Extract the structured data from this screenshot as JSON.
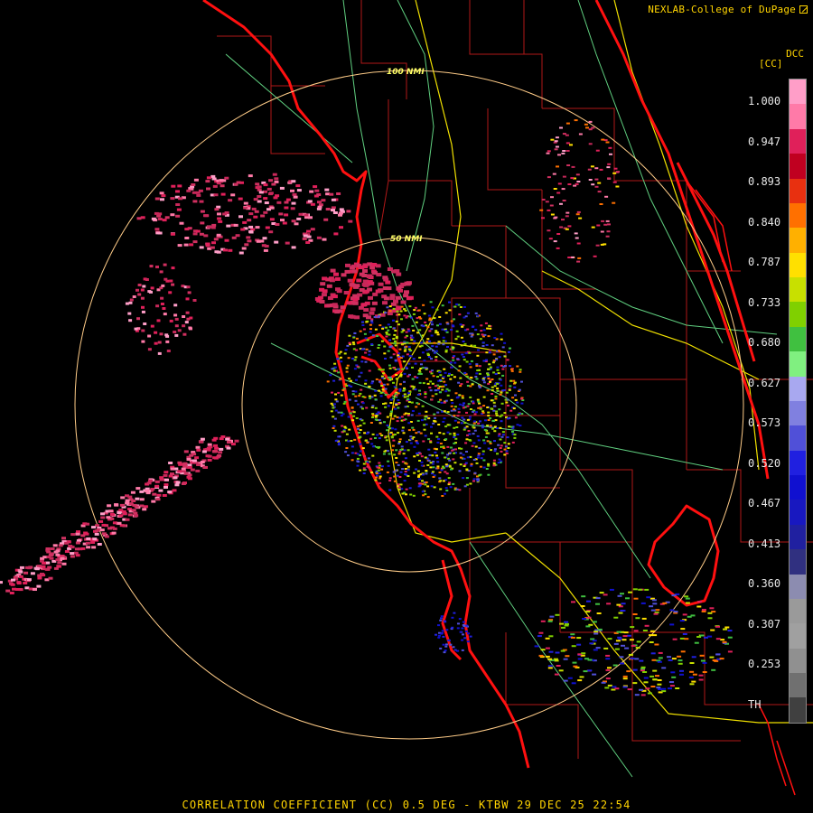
{
  "credit": {
    "text": "NEXLAB-College of DuPage",
    "icon": "external-link-icon"
  },
  "legend": {
    "code": "DCC",
    "product": "[CC]",
    "ticks": [
      "1.000",
      "0.947",
      "0.893",
      "0.840",
      "0.787",
      "0.733",
      "0.680",
      "0.627",
      "0.573",
      "0.520",
      "0.467",
      "0.413",
      "0.360",
      "0.307",
      "0.253",
      "TH"
    ],
    "colors": [
      "#ff9ec8",
      "#ff7aa8",
      "#e0205a",
      "#c00020",
      "#e83010",
      "#ff7000",
      "#ffb000",
      "#ffe000",
      "#c8e000",
      "#80d000",
      "#40c040",
      "#80f080",
      "#a8a8f0",
      "#8080e0",
      "#5050d8",
      "#2020e0",
      "#1010d0",
      "#1818c0",
      "#2020a0",
      "#303080",
      "#8c8cb0",
      "#9a9a9a",
      "#a0a0a0",
      "#909090",
      "#707070",
      "#404040"
    ]
  },
  "range_rings": {
    "inner_label": "50 NMI",
    "outer_label": "100 NMI",
    "color": "#ffcc88"
  },
  "map_colors": {
    "coastline": "#ff1010",
    "county": "#b01818",
    "highway_yellow": "#f0e000",
    "highway_green": "#60d080"
  },
  "bottom_title": "CORRELATION COEFFICIENT (CC) 0.5 DEG - KTBW 29 DEC 25 22:54"
}
